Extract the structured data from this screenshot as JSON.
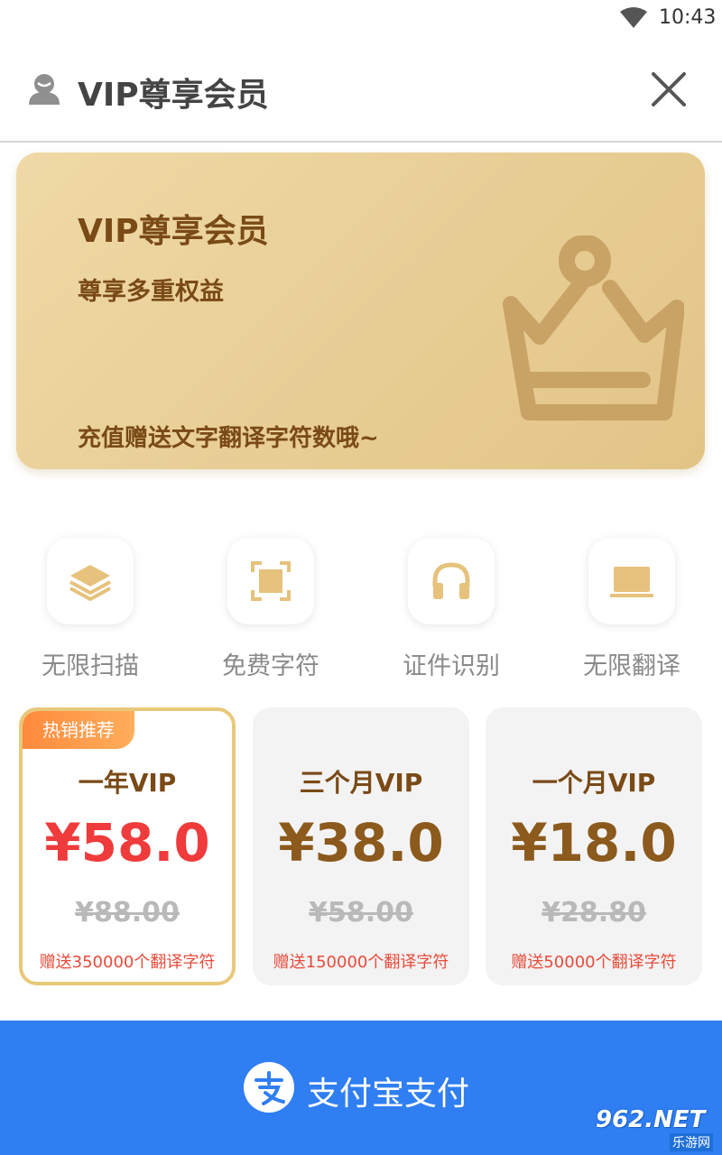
{
  "status_bar": {
    "time": "10:43",
    "wifi_icon": "wifi-icon"
  },
  "header": {
    "title": "VIP尊享会员",
    "avatar_icon": "user-avatar-icon",
    "close_icon": "close-icon"
  },
  "banner": {
    "title": "VIP尊享会员",
    "subtitle": "尊享多重权益",
    "note": "充值赠送文字翻译字符数哦~",
    "icon": "crown-icon"
  },
  "features": [
    {
      "label": "无限扫描",
      "icon": "layers-icon"
    },
    {
      "label": "免费字符",
      "icon": "scan-frame-icon"
    },
    {
      "label": "证件识别",
      "icon": "headphones-icon"
    },
    {
      "label": "无限翻译",
      "icon": "laptop-icon"
    }
  ],
  "plans": [
    {
      "tag": "热销推荐",
      "name": "一年VIP",
      "price": "¥58.0",
      "original": "¥88.00",
      "gift": "赠送350000个翻译字符",
      "selected": true
    },
    {
      "name": "三个月VIP",
      "price": "¥38.0",
      "original": "¥58.00",
      "gift": "赠送150000个翻译字符",
      "selected": false
    },
    {
      "name": "一个月VIP",
      "price": "¥18.0",
      "original": "¥28.80",
      "gift": "赠送50000个翻译字符",
      "selected": false
    }
  ],
  "pay": {
    "label": "支付宝支付",
    "icon": "alipay-icon"
  },
  "watermark": {
    "logo": "962.NET",
    "sub": "乐游网"
  },
  "colors": {
    "accent_gold": "#e2c486",
    "brown_text": "#7a4a16",
    "price_red": "#ef3b3b",
    "pay_blue": "#2f7ef2",
    "tag_orange": "#ff8a3c"
  }
}
